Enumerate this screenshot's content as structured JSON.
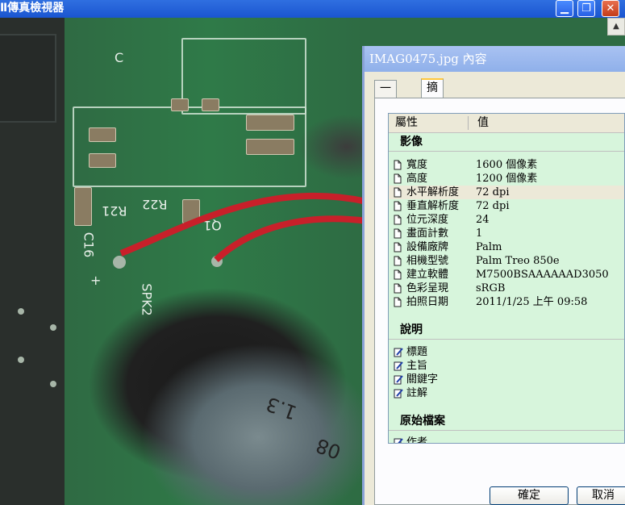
{
  "main_window": {
    "title": "Ⅱ傳真檢視器",
    "minimize_glyph": "▁",
    "maximize_glyph": "❐",
    "close_glyph": "✕",
    "scroll_up_glyph": "▲"
  },
  "photo": {
    "silk_labels": [
      "C",
      "R21",
      "R22",
      "C16",
      "SPK2",
      "+",
      "Q1",
      "1.3",
      "08"
    ]
  },
  "dialog": {
    "title": "IMAG0475.jpg 內容",
    "tabs": [
      {
        "label": "一般",
        "active": false
      },
      {
        "label": "摘要",
        "active": true
      }
    ],
    "columns": {
      "property": "屬性",
      "value": "值"
    },
    "sections": {
      "image": "影像",
      "description": "說明",
      "origin": "原始檔案"
    },
    "image_rows": [
      {
        "key": "寬度",
        "value": "1600 個像素"
      },
      {
        "key": "高度",
        "value": "1200 個像素"
      },
      {
        "key": "水平解析度",
        "value": "72 dpi"
      },
      {
        "key": "垂直解析度",
        "value": "72 dpi"
      },
      {
        "key": "位元深度",
        "value": "24"
      },
      {
        "key": "畫面計數",
        "value": "1"
      },
      {
        "key": "設備廠牌",
        "value": "Palm"
      },
      {
        "key": "相機型號",
        "value": "Palm Treo 850e"
      },
      {
        "key": "建立軟體",
        "value": "M7500BSAAAAAAD3050"
      },
      {
        "key": "色彩呈現",
        "value": "sRGB"
      },
      {
        "key": "拍照日期",
        "value": "2011/1/25 上午 09:58"
      }
    ],
    "description_rows": [
      {
        "key": "標題"
      },
      {
        "key": "主旨"
      },
      {
        "key": "關鍵字"
      },
      {
        "key": "註解"
      }
    ],
    "origin_rows": [
      {
        "key": "作者"
      }
    ],
    "ok_label": "確定",
    "cancel_label": "取消"
  },
  "colors": {
    "titlebar": "#2f6fe0",
    "list_bg": "#d7f5dc",
    "tab_accent": "#ffc83c"
  }
}
